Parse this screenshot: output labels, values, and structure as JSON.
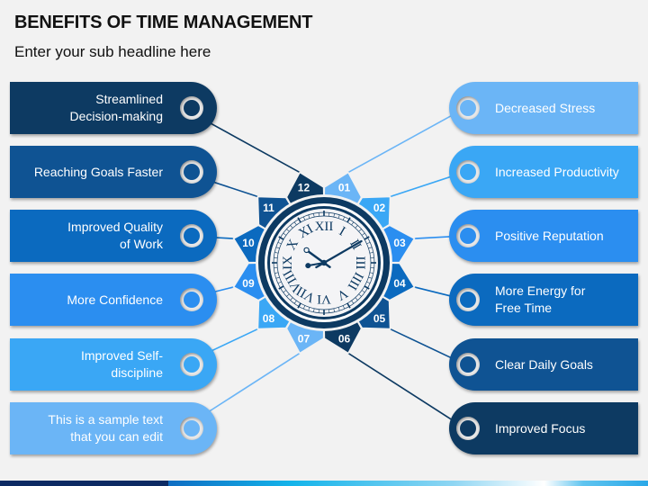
{
  "header": {
    "title": "BENEFITS OF TIME MANAGEMENT",
    "subtitle": "Enter your sub headline here"
  },
  "colors": {
    "darkest": "#0d3a62",
    "dark": "#0f5393",
    "medium": "#0b6abf",
    "bright": "#2b8ef0",
    "sky": "#3aa7f5",
    "light": "#6bb5f6",
    "background": "#f2f2f2"
  },
  "left_items": [
    {
      "label": "Streamlined Decision-making",
      "lines": [
        "Streamlined",
        "Decision-making"
      ],
      "color": "#0d3a62",
      "number": "12"
    },
    {
      "label": "Reaching Goals Faster",
      "lines": [
        "Reaching Goals Faster"
      ],
      "color": "#0f5393",
      "number": "11"
    },
    {
      "label": "Improved Quality of Work",
      "lines": [
        "Improved Quality",
        "of Work"
      ],
      "color": "#0b6abf",
      "number": "10"
    },
    {
      "label": "More Confidence",
      "lines": [
        "More Confidence"
      ],
      "color": "#2b8ef0",
      "number": "09"
    },
    {
      "label": "Improved Self-discipline",
      "lines": [
        "Improved Self-",
        "discipline"
      ],
      "color": "#3aa7f5",
      "number": "08"
    },
    {
      "label": "This is a sample text that you can edit",
      "lines": [
        "This is a sample text",
        "that you can edit"
      ],
      "color": "#6bb5f6",
      "number": "07"
    }
  ],
  "right_items": [
    {
      "label": "Decreased Stress",
      "lines": [
        "Decreased Stress"
      ],
      "color": "#6bb5f6",
      "number": "01"
    },
    {
      "label": "Increased Productivity",
      "lines": [
        "Increased Productivity"
      ],
      "color": "#3aa7f5",
      "number": "02"
    },
    {
      "label": "Positive Reputation",
      "lines": [
        "Positive Reputation"
      ],
      "color": "#2b8ef0",
      "number": "03"
    },
    {
      "label": "More Energy for Free Time",
      "lines": [
        "More Energy for",
        "Free Time"
      ],
      "color": "#0b6abf",
      "number": "04"
    },
    {
      "label": "Clear Daily Goals",
      "lines": [
        "Clear Daily Goals"
      ],
      "color": "#0f5393",
      "number": "05"
    },
    {
      "label": "Improved Focus",
      "lines": [
        "Improved Focus"
      ],
      "color": "#0d3a62",
      "number": "06"
    }
  ],
  "clock": {
    "numerals": [
      "XII",
      "I",
      "II",
      "III",
      "IIII",
      "V",
      "VI",
      "VII",
      "VIII",
      "IX",
      "X",
      "XI"
    ],
    "hour_hand_hours": 10.2,
    "minute_hand_minutes": 10
  }
}
